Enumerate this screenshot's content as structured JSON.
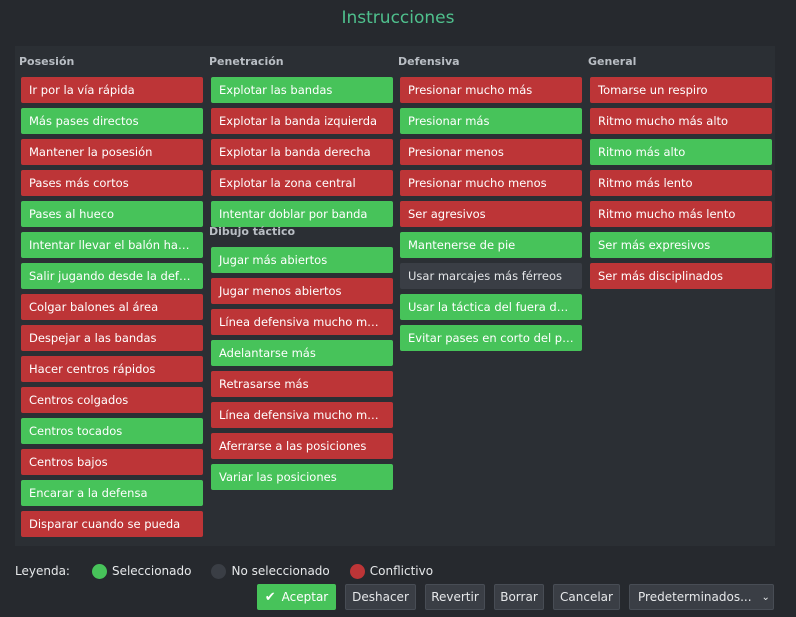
{
  "window_title": "Instrucciones",
  "columns": [
    {
      "sections": [
        {
          "header": "Posesión",
          "items": [
            {
              "label": "Ir por la vía rápida",
              "state": "conf"
            },
            {
              "label": "Más pases directos",
              "state": "sel"
            },
            {
              "label": "Mantener la posesión",
              "state": "conf"
            },
            {
              "label": "Pases más cortos",
              "state": "conf"
            },
            {
              "label": "Pases al hueco",
              "state": "sel"
            },
            {
              "label": "Intentar llevar el balón hast…",
              "state": "sel"
            },
            {
              "label": "Salir jugando desde la defe…",
              "state": "sel"
            },
            {
              "label": "Colgar balones al área",
              "state": "conf"
            },
            {
              "label": "Despejar a las bandas",
              "state": "conf"
            },
            {
              "label": "Hacer centros rápidos",
              "state": "conf"
            },
            {
              "label": "Centros colgados",
              "state": "conf"
            },
            {
              "label": "Centros tocados",
              "state": "sel"
            },
            {
              "label": "Centros bajos",
              "state": "conf"
            },
            {
              "label": "Encarar a la defensa",
              "state": "sel"
            },
            {
              "label": "Disparar cuando se pueda",
              "state": "conf"
            }
          ]
        }
      ]
    },
    {
      "sections": [
        {
          "header": "Penetración",
          "items": [
            {
              "label": "Explotar las bandas",
              "state": "sel"
            },
            {
              "label": "Explotar la banda izquierda",
              "state": "conf"
            },
            {
              "label": "Explotar la banda derecha",
              "state": "conf"
            },
            {
              "label": "Explotar la zona central",
              "state": "conf"
            },
            {
              "label": "Intentar doblar por banda",
              "state": "sel"
            }
          ]
        },
        {
          "header": "Dibujo táctico",
          "items": [
            {
              "label": "Jugar más abiertos",
              "state": "sel"
            },
            {
              "label": "Jugar menos abiertos",
              "state": "conf"
            },
            {
              "label": "Línea defensiva mucho más…",
              "state": "conf"
            },
            {
              "label": "Adelantarse más",
              "state": "sel"
            },
            {
              "label": "Retrasarse más",
              "state": "conf"
            },
            {
              "label": "Línea defensiva mucho más…",
              "state": "conf"
            },
            {
              "label": "Aferrarse a las posiciones",
              "state": "conf"
            },
            {
              "label": "Variar las posiciones",
              "state": "sel"
            }
          ]
        }
      ]
    },
    {
      "sections": [
        {
          "header": "Defensiva",
          "items": [
            {
              "label": "Presionar mucho más",
              "state": "conf"
            },
            {
              "label": "Presionar más",
              "state": "sel"
            },
            {
              "label": "Presionar menos",
              "state": "conf"
            },
            {
              "label": "Presionar mucho menos",
              "state": "conf"
            },
            {
              "label": "Ser agresivos",
              "state": "conf"
            },
            {
              "label": "Mantenerse de pie",
              "state": "sel"
            },
            {
              "label": "Usar marcajes más férreos",
              "state": "none"
            },
            {
              "label": "Usar la táctica del fuera de j…",
              "state": "sel"
            },
            {
              "label": "Evitar pases en corto del po…",
              "state": "sel"
            }
          ]
        }
      ]
    },
    {
      "sections": [
        {
          "header": "General",
          "items": [
            {
              "label": "Tomarse un respiro",
              "state": "conf"
            },
            {
              "label": "Ritmo mucho más alto",
              "state": "conf"
            },
            {
              "label": "Ritmo más alto",
              "state": "sel"
            },
            {
              "label": "Ritmo más lento",
              "state": "conf"
            },
            {
              "label": "Ritmo mucho más lento",
              "state": "conf"
            },
            {
              "label": "Ser más expresivos",
              "state": "sel"
            },
            {
              "label": "Ser más disciplinados",
              "state": "conf"
            }
          ]
        }
      ]
    }
  ],
  "legend": {
    "label": "Leyenda:",
    "selected": "Seleccionado",
    "not_selected": "No seleccionado",
    "conflict": "Conflictivo",
    "colors": {
      "selected": "#47c35a",
      "not_selected": "#3a3e45",
      "conflict": "#bd3537"
    }
  },
  "buttons": {
    "accept": "Aceptar",
    "undo": "Deshacer",
    "revert": "Revertir",
    "clear": "Borrar",
    "cancel": "Cancelar",
    "defaults": "Predeterminados..."
  }
}
